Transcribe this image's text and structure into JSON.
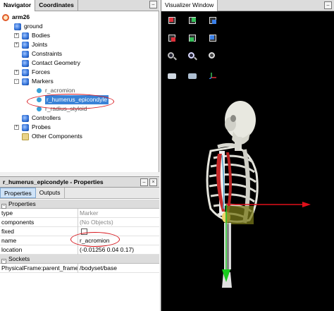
{
  "navigator": {
    "tabs": [
      "Navigator",
      "Coordinates"
    ],
    "tree": [
      {
        "label": "arm26",
        "icon": "model-root-icon",
        "expander": "",
        "bold": true
      },
      {
        "label": "ground",
        "icon": "ground-icon",
        "expander": ""
      },
      {
        "label": "Bodies",
        "icon": "bodies-icon",
        "expander": "+"
      },
      {
        "label": "Joints",
        "icon": "joints-icon",
        "expander": "+"
      },
      {
        "label": "Constraints",
        "icon": "constraints-icon",
        "expander": ""
      },
      {
        "label": "Contact Geometry",
        "icon": "contact-geometry-icon",
        "expander": ""
      },
      {
        "label": "Forces",
        "icon": "forces-icon",
        "expander": "+"
      },
      {
        "label": "Markers",
        "icon": "markers-icon",
        "expander": "-"
      },
      {
        "label": "r_acromion",
        "icon": "marker-icon",
        "expander": ""
      },
      {
        "label": "r_humerus_epicondyle",
        "icon": "marker-icon",
        "expander": "",
        "selected": true
      },
      {
        "label": "r_radius_styloid",
        "icon": "marker-icon",
        "expander": ""
      },
      {
        "label": "Controllers",
        "icon": "controllers-icon",
        "expander": ""
      },
      {
        "label": "Probes",
        "icon": "probes-icon",
        "expander": "+"
      },
      {
        "label": "Other Components",
        "icon": "other-components-icon",
        "expander": ""
      }
    ]
  },
  "properties": {
    "title": "r_humerus_epicondyle - Properties",
    "tabs": [
      "Properties",
      "Outputs"
    ],
    "sections": {
      "properties": "Properties",
      "sockets": "Sockets"
    },
    "rows": {
      "type": {
        "key": "type",
        "value": "Marker"
      },
      "components": {
        "key": "components",
        "value": "(No Objects)"
      },
      "fixed": {
        "key": "fixed",
        "value": ""
      },
      "name": {
        "key": "name",
        "value": "r_acromion"
      },
      "location": {
        "key": "location",
        "value": "(-0.01256 0.04 0.17)"
      },
      "parent_frame": {
        "key": "PhysicalFrame:parent_frame",
        "value": "/bodyset/base"
      }
    }
  },
  "visualizer": {
    "title": "Visualizer Window",
    "toolbar": [
      "front-view-icon",
      "top-view-icon",
      "right-view-icon",
      "back-view-icon",
      "bottom-view-icon",
      "left-view-icon",
      "zoom-out-icon",
      "zoom-in-icon",
      "fit-view-icon",
      "camera-icon",
      "record-icon",
      "axes-icon"
    ]
  },
  "window_controls": {
    "minimize": "–",
    "close": "×"
  },
  "colors": {
    "selection": "#3a82d6",
    "annotation_circle": "#d8151c",
    "viz_background": "#000000"
  }
}
